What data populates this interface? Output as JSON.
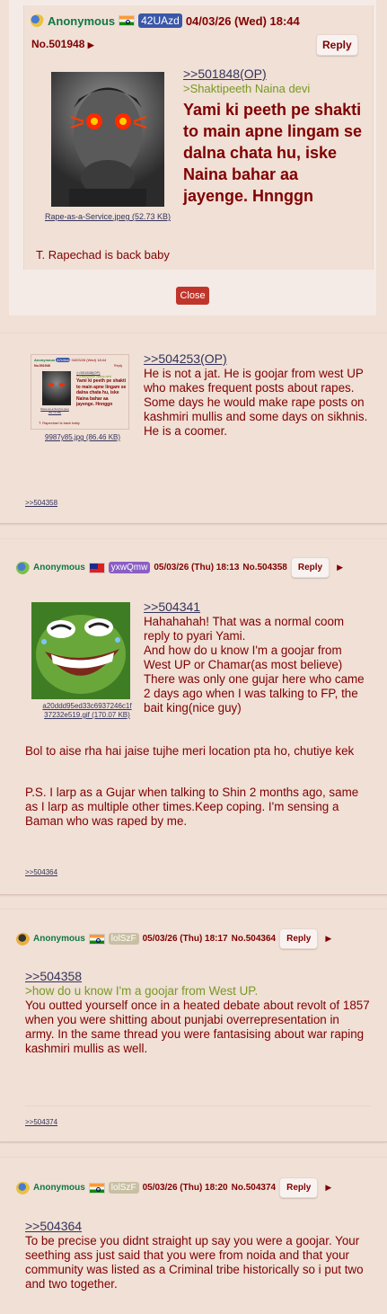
{
  "op_preview": {
    "name": "Anonymous",
    "id": "42UAzd",
    "date": "04/03/26 (Wed) 18:44",
    "post_no": "No.501948",
    "reply_label": "Reply",
    "file_name": "Rape-as-a-Service.jpeg (52.73 KB)",
    "quote_link": ">>501848(OP)",
    "greentext": ">Shaktipeeth Naina devi",
    "big_text": "Yami ki peeth pe shakti to main apne lingam se dalna chata hu, iske Naina bahar aa jayenge. Hnnggn",
    "footer": "T. Rapechad is back baby",
    "close_label": "Close",
    "thumb_icon": "sigma-face-red-eyes-image"
  },
  "post_504358": {
    "thumb_file": "9987y85.jpg (86.46 KB)",
    "quote_link": ">>504253(OP)",
    "body": "He is not a jat. He is goojar from west UP who makes frequent posts about rapes. Some days he would make rape posts on kashmiri mullis and some days on sikhnis. He is a coomer.",
    "backlink": ">>504358",
    "mini": {
      "name": "Anonymous",
      "id": "42UAzd",
      "date": "04/03/26 (Wed) 18:44",
      "no": "No.501948",
      "reply": "Reply",
      "ref": ">>501848(OP)",
      "green": ">Shaktipeeth Naina devi",
      "text": "Yami ki peeth pe shakti to main apne lingam se dalna chata hu, iske Naina bahar aa jayenge. Hnnggn",
      "file": "Rape-as-a-Service.jpeg (52.73 KB)",
      "footer": "T. Rapechad is back baby"
    }
  },
  "post_504364": {
    "name": "Anonymous",
    "id": "yxwQmw",
    "date": "05/03/26 (Thu) 18:13",
    "post_no": "No.504358",
    "reply_label": "Reply",
    "file_name": "a20ddd95ed33c6937246c1f37232e519.gif (170.07 KB)",
    "quote_link": ">>504341",
    "body_1": "Hahahahah! That was a normal coom reply to pyari Yami.",
    "body_2": "And how do u know I'm a goojar from West UP or Chamar(as most believe)",
    "body_3": "There was only one gujar here who came 2 days ago when I was talking to FP, the bait king(nice guy)",
    "body_4": "Bol to aise rha hai jaise tujhe meri location pta ho, chutiye kek",
    "body_5": "P.S. I larp as a Gujar when talking to Shin 2 months ago, same as I larp as multiple other times.Keep coping. I'm sensing a Baman who was raped by me.",
    "backlink": ">>504364",
    "flag_icon": "taiwan-flag-icon",
    "thumb_icon": "pepe-laughing-image"
  },
  "post_504374": {
    "name": "Anonymous",
    "id": "lolSzF",
    "date": "05/03/26 (Thu) 18:17",
    "post_no": "No.504364",
    "reply_label": "Reply",
    "quote_link": ">>504358",
    "greentext": ">how do u know I'm a goojar from West UP.",
    "body": "You outted yourself once in a heated debate about revolt of 1857 when you were shitting about punjabi overrepresentation in army. In the same thread you were fantasising about war raping kashmiri mullis as well.",
    "backlink": ">>504374"
  },
  "post_last": {
    "name": "Anonymous",
    "id": "lolSzF",
    "date": "05/03/26 (Thu) 18:20",
    "post_no": "No.504374",
    "reply_label": "Reply",
    "quote_link": ">>504364",
    "body": "To be precise you didnt straight up say you were a goojar. Your seething ass just said that you were from noida and that your community was listed as a Criminal tribe historically so i put two and two together."
  }
}
